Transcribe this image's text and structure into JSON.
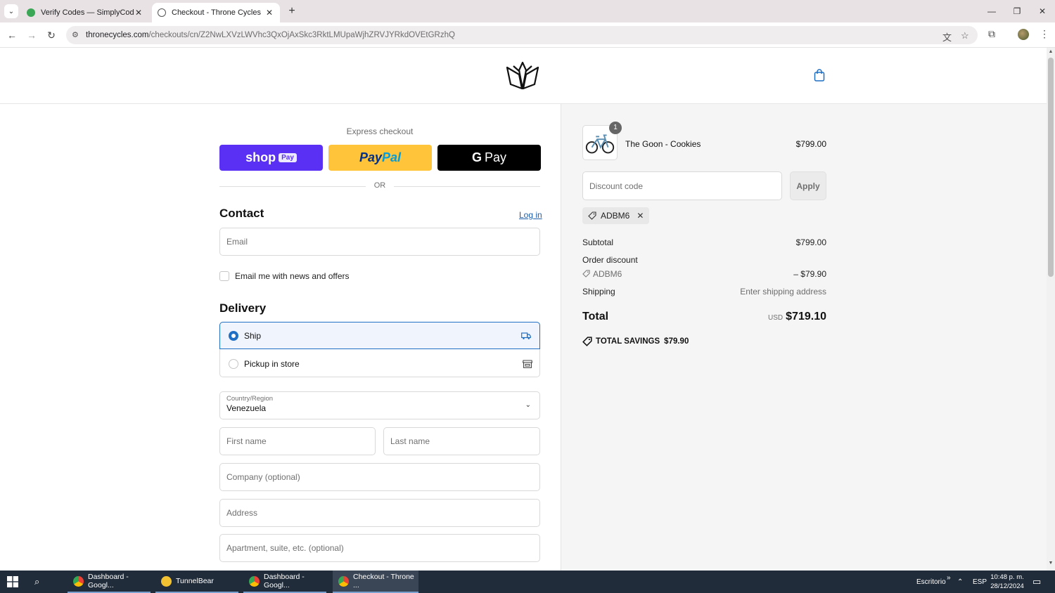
{
  "browser": {
    "tabs": [
      {
        "title": "Verify Codes — SimplyCodes",
        "active": false
      },
      {
        "title": "Checkout - Throne Cycles",
        "active": true
      }
    ],
    "url_host": "thronecycles.com",
    "url_path": "/checkouts/cn/Z2NwLXVzLWVhc3QxOjAxSkc3RktLMUpaWjhZRVJYRkdOVEtGRzhQ"
  },
  "express": {
    "label": "Express checkout",
    "shop": "shop",
    "shop_pay": "Pay",
    "paypal_a": "Pay",
    "paypal_b": "Pal",
    "gpay_g": "G",
    "gpay": "Pay",
    "or": "OR"
  },
  "contact": {
    "title": "Contact",
    "login": "Log in",
    "email_placeholder": "Email",
    "newsletter": "Email me with news and offers"
  },
  "delivery": {
    "title": "Delivery",
    "ship": "Ship",
    "pickup": "Pickup in store",
    "selected": "Ship",
    "country_label": "Country/Region",
    "country_value": "Venezuela",
    "first_name": "First name",
    "last_name": "Last name",
    "company": "Company (optional)",
    "address": "Address",
    "apartment": "Apartment, suite, etc. (optional)"
  },
  "summary": {
    "product_name": "The Goon - Cookies",
    "product_price": "$799.00",
    "quantity": "1",
    "discount_placeholder": "Discount code",
    "apply": "Apply",
    "applied_code": "ADBM6",
    "subtotal_label": "Subtotal",
    "subtotal": "$799.00",
    "order_discount_label": "Order discount",
    "discount_code": "ADBM6",
    "discount_amount": "– $79.90",
    "shipping_label": "Shipping",
    "shipping_value": "Enter shipping address",
    "total_label": "Total",
    "currency": "USD",
    "total": "$719.10",
    "savings_label": "TOTAL SAVINGS",
    "savings": "$79.90"
  },
  "taskbar": {
    "apps": [
      {
        "label": "Dashboard - Googl..."
      },
      {
        "label": "TunnelBear"
      },
      {
        "label": "Dashboard - Googl..."
      },
      {
        "label": "Checkout - Throne ..."
      }
    ],
    "desktop": "Escritorio",
    "lang": "ESP",
    "time": "10:48 p. m.",
    "date": "28/12/2024"
  },
  "colors": {
    "accent": "#1f6fc4",
    "shop_pay": "#5a31f4",
    "paypal": "#ffc439"
  }
}
